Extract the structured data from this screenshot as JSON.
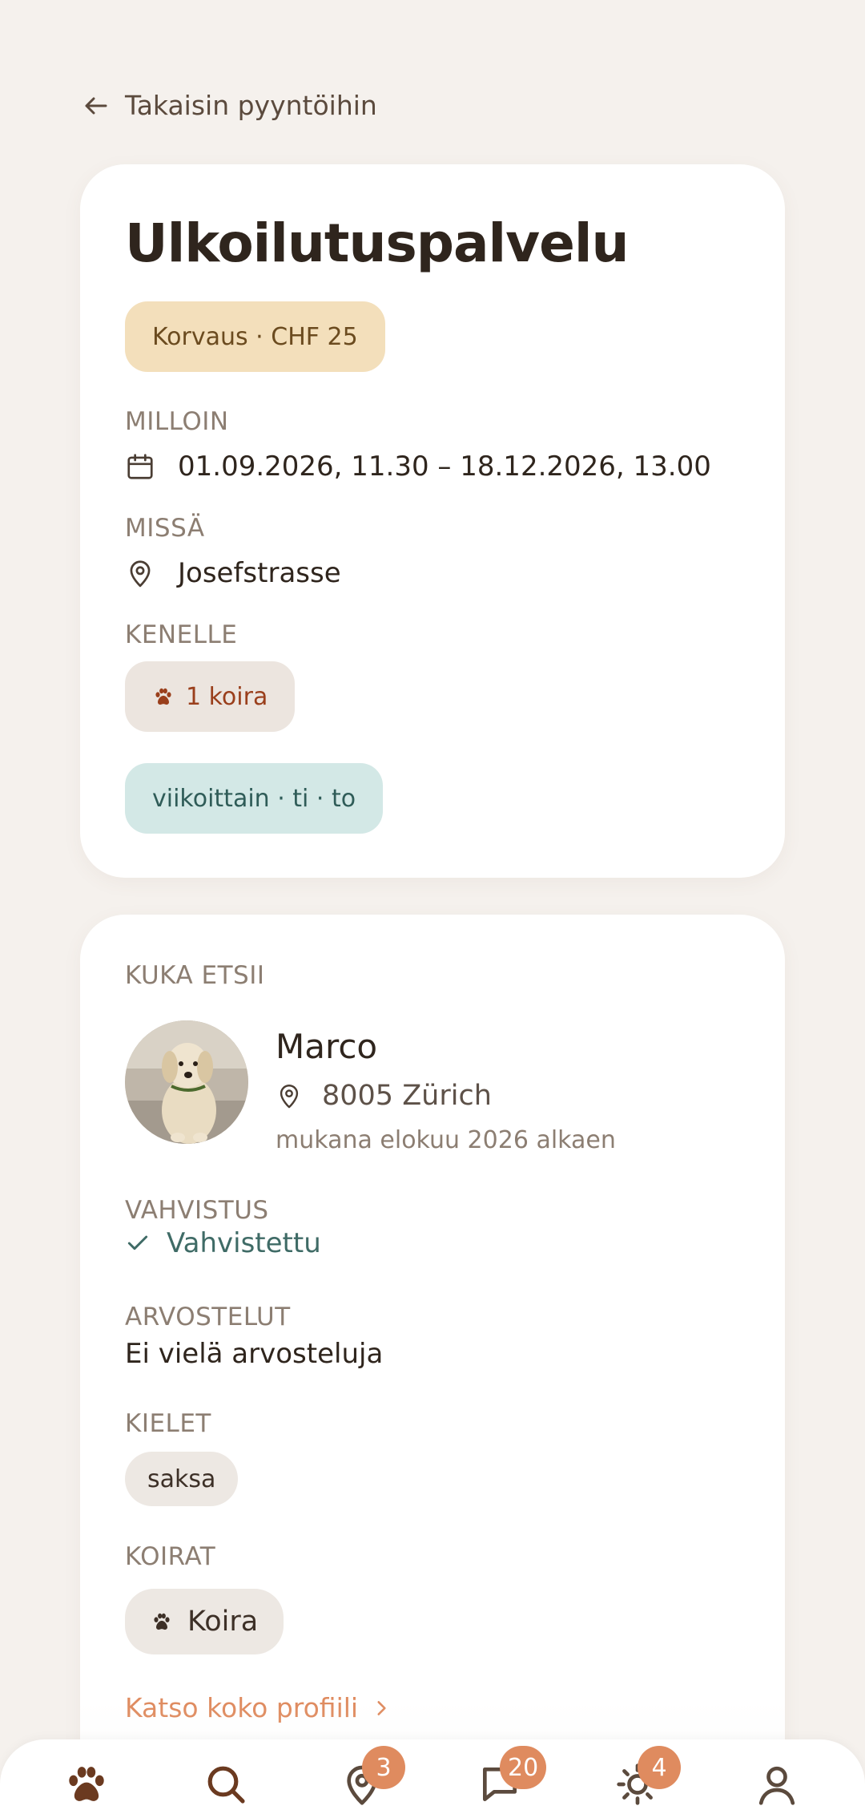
{
  "back_link": {
    "label": "Takaisin pyyntöihin"
  },
  "request": {
    "title": "Ulkoilutuspalvelu",
    "compensation": "Korvaus · CHF 25",
    "when": {
      "label": "MILLOIN",
      "value": "01.09.2026, 11.30 – 18.12.2026, 13.00"
    },
    "where": {
      "label": "MISSÄ",
      "value": "Josefstrasse"
    },
    "for_whom": {
      "label": "KENELLE",
      "value": "1 koira"
    },
    "recurrence": "viikoittain · ti · to"
  },
  "owner": {
    "section_label": "KUKA ETSII",
    "name": "Marco",
    "location": "8005 Zürich",
    "member_since": "mukana elokuu 2026 alkaen",
    "verification": {
      "label": "VAHVISTUS",
      "value": "Vahvistettu"
    },
    "reviews": {
      "label": "ARVOSTELUT",
      "value": "Ei vielä arvosteluja"
    },
    "languages": {
      "label": "KIELET",
      "items": [
        "saksa"
      ]
    },
    "dogs": {
      "label": "KOIRAT",
      "items": [
        "Koira"
      ]
    },
    "profile_link": "Katso koko profiili"
  },
  "nav": {
    "items": [
      {
        "icon": "paw-icon",
        "active": true
      },
      {
        "icon": "search-icon"
      },
      {
        "icon": "map-pin-icon",
        "badge": "3"
      },
      {
        "icon": "chat-icon",
        "badge": "20"
      },
      {
        "icon": "sun-icon",
        "badge": "4"
      },
      {
        "icon": "user-icon"
      }
    ]
  },
  "colors": {
    "background": "#f5f1ed",
    "accent": "#df8b5f",
    "compensation_pill": "#f3dfbb",
    "recurrence_pill": "#d3e8e6",
    "verified": "#3f6b66",
    "active_nav": "#6b3a20"
  }
}
